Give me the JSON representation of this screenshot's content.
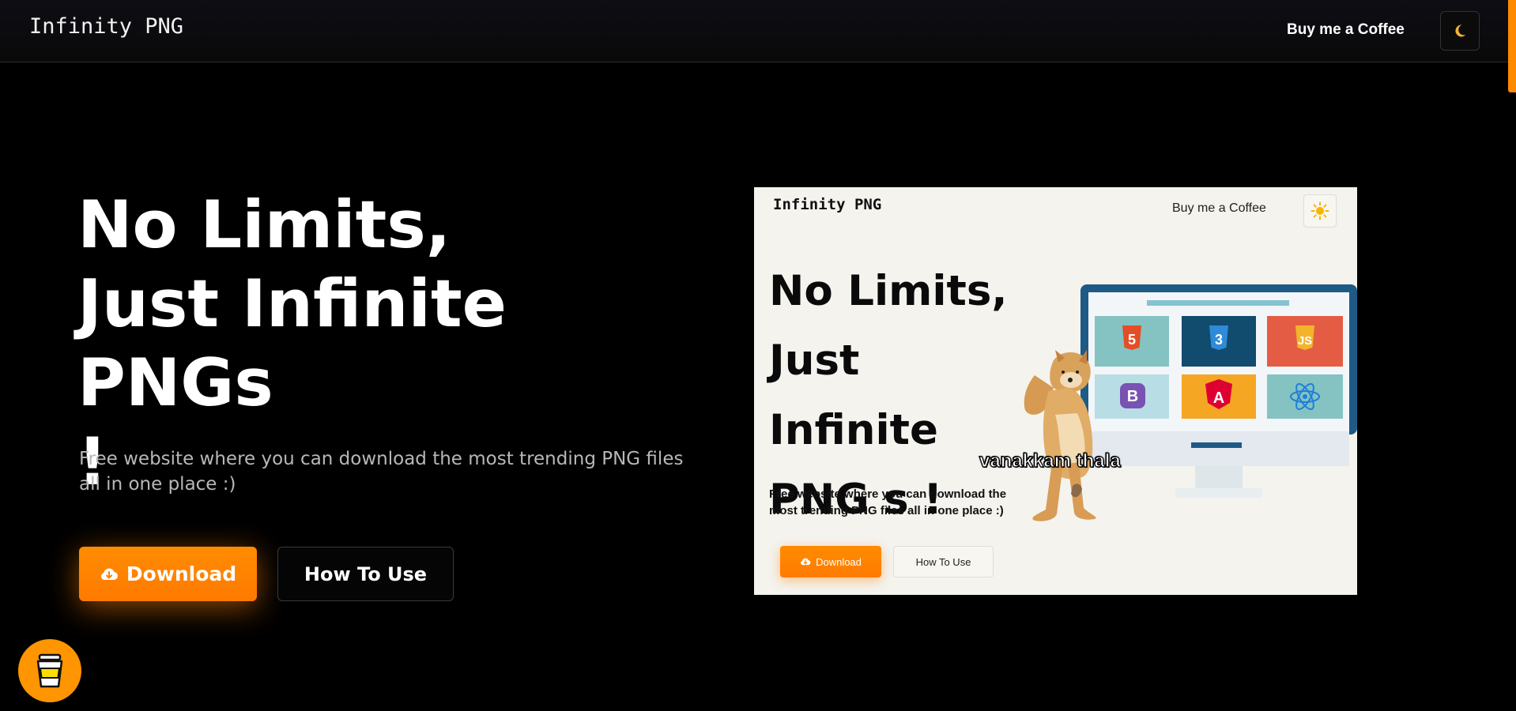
{
  "nav": {
    "logo": "Infinity PNG",
    "coffee_link": "Buy me a Coffee",
    "theme_toggle_icon": "moon-icon"
  },
  "hero": {
    "title_line1": "No Limits,",
    "title_line2": "Just Infinite PNGs",
    "title_line3": "!",
    "subtitle": "Free website where you can download the most trending PNG files all in one place :)",
    "download_label": "Download",
    "download_icon": "cloud-download-icon",
    "howto_label": "How To Use"
  },
  "preview": {
    "logo": "Infinity PNG",
    "coffee_link": "Buy me a Coffee",
    "theme_icon": "sun-icon",
    "title_line1": "No Limits,",
    "title_line2": "Just Infinite",
    "title_line3": "PNG s !",
    "subtitle": "Free website where you can download the most trending PNG files all in one place :)",
    "download_label": "Download",
    "howto_label": "How To Use",
    "meme_caption": "vanakkam thala",
    "tech_logos": [
      "html5",
      "css3",
      "js",
      "bootstrap",
      "angular",
      "react"
    ]
  },
  "fab": {
    "icon": "coffee-cup-icon"
  },
  "colors": {
    "accent": "#ff8a00",
    "background": "#000000",
    "preview_bg": "#f4f3ee"
  }
}
